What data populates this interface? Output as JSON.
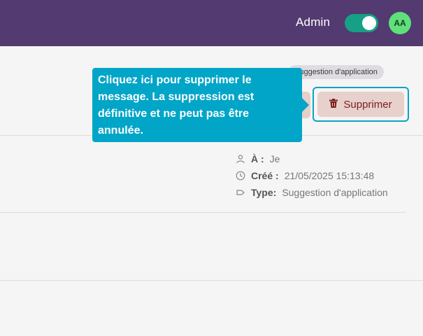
{
  "header": {
    "admin_label": "Admin",
    "admin_toggle_on": true,
    "avatar_initials": "AA",
    "colors": {
      "bar": "#533a71",
      "toggle": "#16a085",
      "avatar": "#5ee07a"
    }
  },
  "message": {
    "tag": "Suggestion d'application",
    "delete_button_label": "Supprimer",
    "meta": {
      "to_label": "À :",
      "to_value": "Je",
      "created_label": "Créé :",
      "created_value": "21/05/2025 15:13:48",
      "type_label": "Type:",
      "type_value": "Suggestion d'application"
    }
  },
  "tooltip": {
    "text": "Cliquez ici pour supprimer le message. La suppression est définitive et ne peut pas être annulée.",
    "color": "#00a5c8"
  },
  "icons": [
    "user-icon",
    "clock-icon",
    "tag-icon",
    "trash-icon"
  ]
}
